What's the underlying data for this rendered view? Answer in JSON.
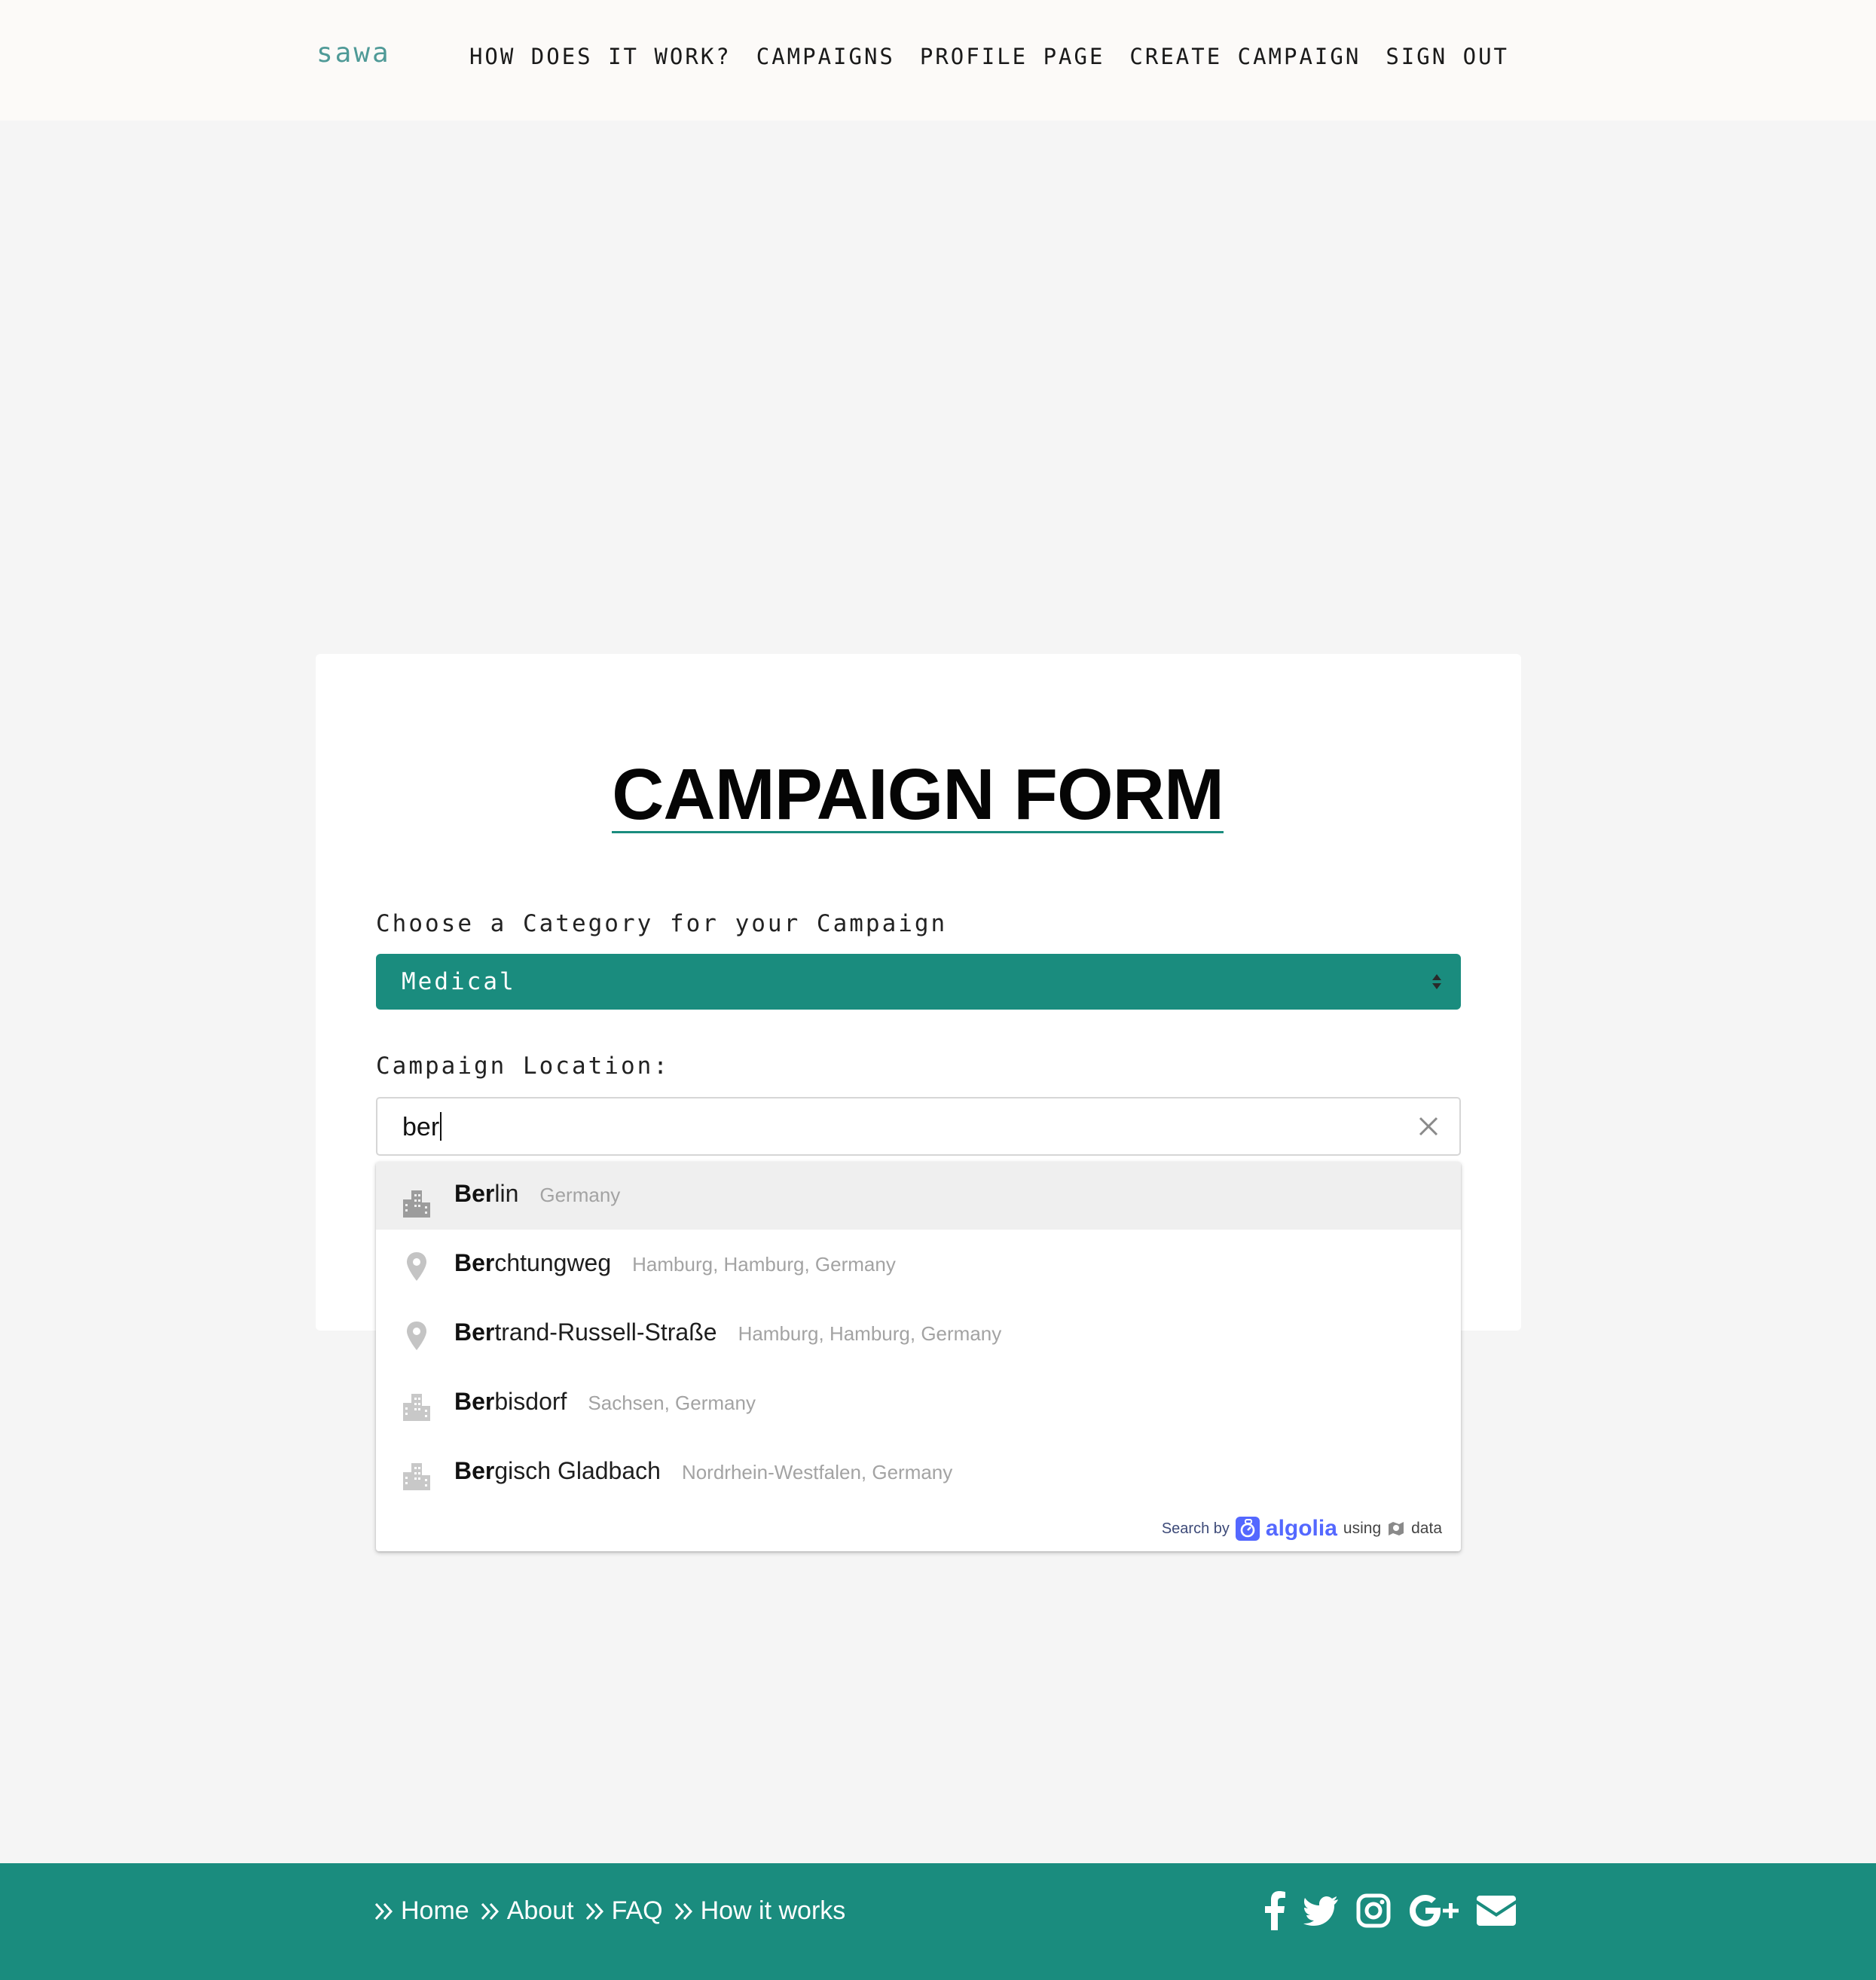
{
  "header": {
    "logo": "sawa",
    "nav": [
      "HOW DOES IT WORK?",
      "CAMPAIGNS",
      "PROFILE PAGE",
      "CREATE CAMPAIGN",
      "SIGN OUT"
    ]
  },
  "form": {
    "title": "CAMPAIGN FORM",
    "category_label": "Choose a Category for your Campaign",
    "category_value": "Medical",
    "location_label": "Campaign Location:",
    "location_value": "ber"
  },
  "suggestions": [
    {
      "match": "Ber",
      "rest": "lin",
      "region": "Germany",
      "icon": "city-icon"
    },
    {
      "match": "Ber",
      "rest": "chtungweg",
      "region": "Hamburg, Hamburg, Germany",
      "icon": "map-pin-icon"
    },
    {
      "match": "Ber",
      "rest": "trand-Russell-Straße",
      "region": "Hamburg, Hamburg, Germany",
      "icon": "map-pin-icon"
    },
    {
      "match": "Ber",
      "rest": "bisdorf",
      "region": "Sachsen, Germany",
      "icon": "city-icon"
    },
    {
      "match": "Ber",
      "rest": "gisch Gladbach",
      "region": "Nordrhein-Westfalen, Germany",
      "icon": "city-icon"
    }
  ],
  "attribution": {
    "search_by": "Search by",
    "brand": "algolia",
    "using": "using",
    "data": "data"
  },
  "footer": {
    "links": [
      "Home",
      "About",
      "FAQ",
      "How it works"
    ],
    "social": [
      "facebook-icon",
      "twitter-icon",
      "instagram-icon",
      "google-plus-icon",
      "envelope-icon"
    ]
  },
  "colors": {
    "accent": "#1a8c7e",
    "logo": "#4f9a97",
    "navbar_bg": "#fcfaf8",
    "page_bg": "#f5f5f5",
    "algolia": "#5468ff"
  }
}
